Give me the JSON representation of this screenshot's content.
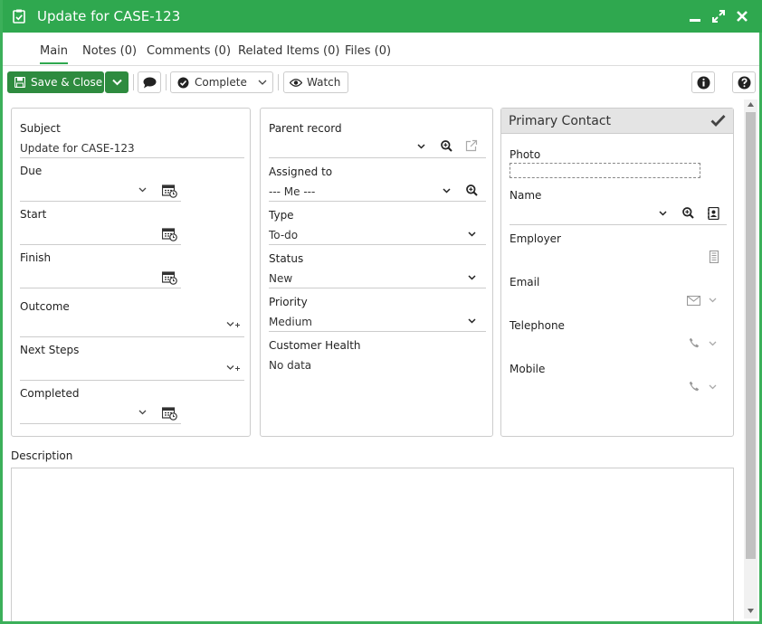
{
  "window": {
    "title": "Update for CASE-123"
  },
  "tabs": [
    {
      "label": "Main"
    },
    {
      "label": "Notes (0)"
    },
    {
      "label": "Comments (0)"
    },
    {
      "label": "Related Items (0)"
    },
    {
      "label": "Files (0)"
    }
  ],
  "toolbar": {
    "save_close": "Save & Close",
    "complete": "Complete",
    "watch": "Watch"
  },
  "left": {
    "subject_label": "Subject",
    "subject_value": "Update for CASE-123",
    "due_label": "Due",
    "start_label": "Start",
    "finish_label": "Finish",
    "outcome_label": "Outcome",
    "next_steps_label": "Next Steps",
    "completed_label": "Completed"
  },
  "middle": {
    "parent_label": "Parent record",
    "assigned_label": "Assigned to",
    "assigned_value": "--- Me ---",
    "type_label": "Type",
    "type_value": "To-do",
    "status_label": "Status",
    "status_value": "New",
    "priority_label": "Priority",
    "priority_value": "Medium",
    "health_label": "Customer Health",
    "health_value": "No data"
  },
  "contact": {
    "header": "Primary Contact",
    "photo_label": "Photo",
    "name_label": "Name",
    "employer_label": "Employer",
    "email_label": "Email",
    "telephone_label": "Telephone",
    "mobile_label": "Mobile"
  },
  "description": {
    "label": "Description"
  },
  "colors": {
    "accent": "#2fa84f",
    "button_green": "#2e8b3f"
  }
}
